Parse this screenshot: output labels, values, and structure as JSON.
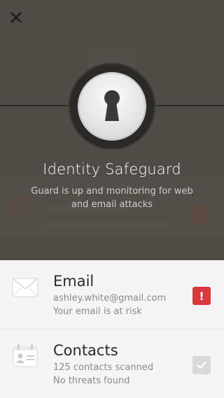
{
  "header": {
    "close_icon": "close-icon"
  },
  "hero": {
    "icon": "keyhole-lock-icon",
    "title": "Identity Safeguard",
    "subtitle": "Guard is up and monitoring for web and email attacks"
  },
  "items": [
    {
      "icon": "envelope-icon",
      "title": "Email",
      "line1": "ashley.white@gmail.com",
      "line2": "Your email is at risk",
      "status": "alert",
      "status_symbol": "!",
      "status_color": "#d7393c"
    },
    {
      "icon": "contact-card-icon",
      "title": "Contacts",
      "line1": "125 contacts scanned",
      "line2": "No threats found",
      "status": "ok",
      "status_color": "#d8d8d8"
    }
  ]
}
